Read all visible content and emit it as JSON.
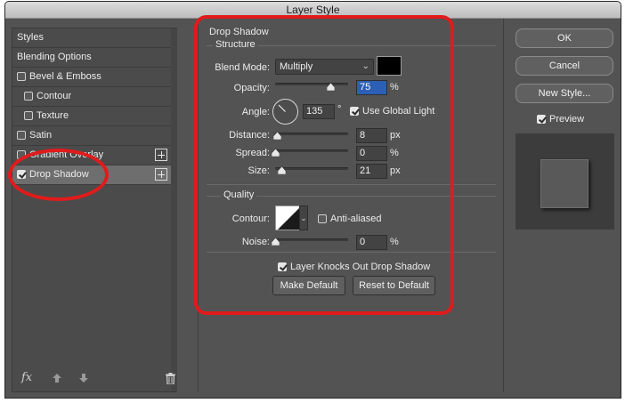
{
  "window": {
    "title": "Layer Style"
  },
  "styles_list": {
    "items": [
      {
        "label": "Styles",
        "has_checkbox": false,
        "checked": false,
        "selected": false,
        "has_plus": false
      },
      {
        "label": "Blending Options",
        "has_checkbox": false,
        "checked": false,
        "selected": false,
        "has_plus": false
      },
      {
        "label": "Bevel & Emboss",
        "has_checkbox": true,
        "checked": false,
        "selected": false,
        "has_plus": false
      },
      {
        "label": "Contour",
        "has_checkbox": true,
        "checked": false,
        "selected": false,
        "has_plus": false
      },
      {
        "label": "Texture",
        "has_checkbox": true,
        "checked": false,
        "selected": false,
        "has_plus": false
      },
      {
        "label": "Satin",
        "has_checkbox": true,
        "checked": false,
        "selected": false,
        "has_plus": false
      },
      {
        "label": "Gradient Overlay",
        "has_checkbox": true,
        "checked": false,
        "selected": false,
        "has_plus": true
      },
      {
        "label": "Drop Shadow",
        "has_checkbox": true,
        "checked": true,
        "selected": true,
        "has_plus": true
      }
    ],
    "bottom_icons": [
      "fx-icon",
      "move-up-icon",
      "move-down-icon",
      "trash-icon"
    ],
    "fx_label": "fx"
  },
  "drop_shadow": {
    "title": "Drop Shadow",
    "structure": {
      "title": "Structure",
      "blend_mode_label": "Blend Mode:",
      "blend_mode_value": "Multiply",
      "shadow_color": "#000000",
      "opacity_label": "Opacity:",
      "opacity_value": "75",
      "opacity_unit": "%",
      "opacity_fraction": 0.75,
      "angle_label": "Angle:",
      "angle_value": "135",
      "angle_unit": "°",
      "use_global_light_label": "Use Global Light",
      "use_global_light_checked": true,
      "distance_label": "Distance:",
      "distance_value": "8",
      "distance_unit": "px",
      "distance_fraction": 0.03,
      "spread_label": "Spread:",
      "spread_value": "0",
      "spread_unit": "%",
      "spread_fraction": 0.0,
      "size_label": "Size:",
      "size_value": "21",
      "size_unit": "px",
      "size_fraction": 0.08
    },
    "quality": {
      "title": "Quality",
      "contour_label": "Contour:",
      "anti_aliased_label": "Anti-aliased",
      "anti_aliased_checked": false,
      "noise_label": "Noise:",
      "noise_value": "0",
      "noise_unit": "%",
      "noise_fraction": 0.0
    },
    "layer_knocks_out_label": "Layer Knocks Out Drop Shadow",
    "layer_knocks_out_checked": true,
    "make_default_label": "Make Default",
    "reset_to_default_label": "Reset to Default"
  },
  "right_panel": {
    "ok_label": "OK",
    "cancel_label": "Cancel",
    "new_style_label": "New Style...",
    "preview_label": "Preview",
    "preview_checked": true
  },
  "annotation_color": "#e11b1b"
}
